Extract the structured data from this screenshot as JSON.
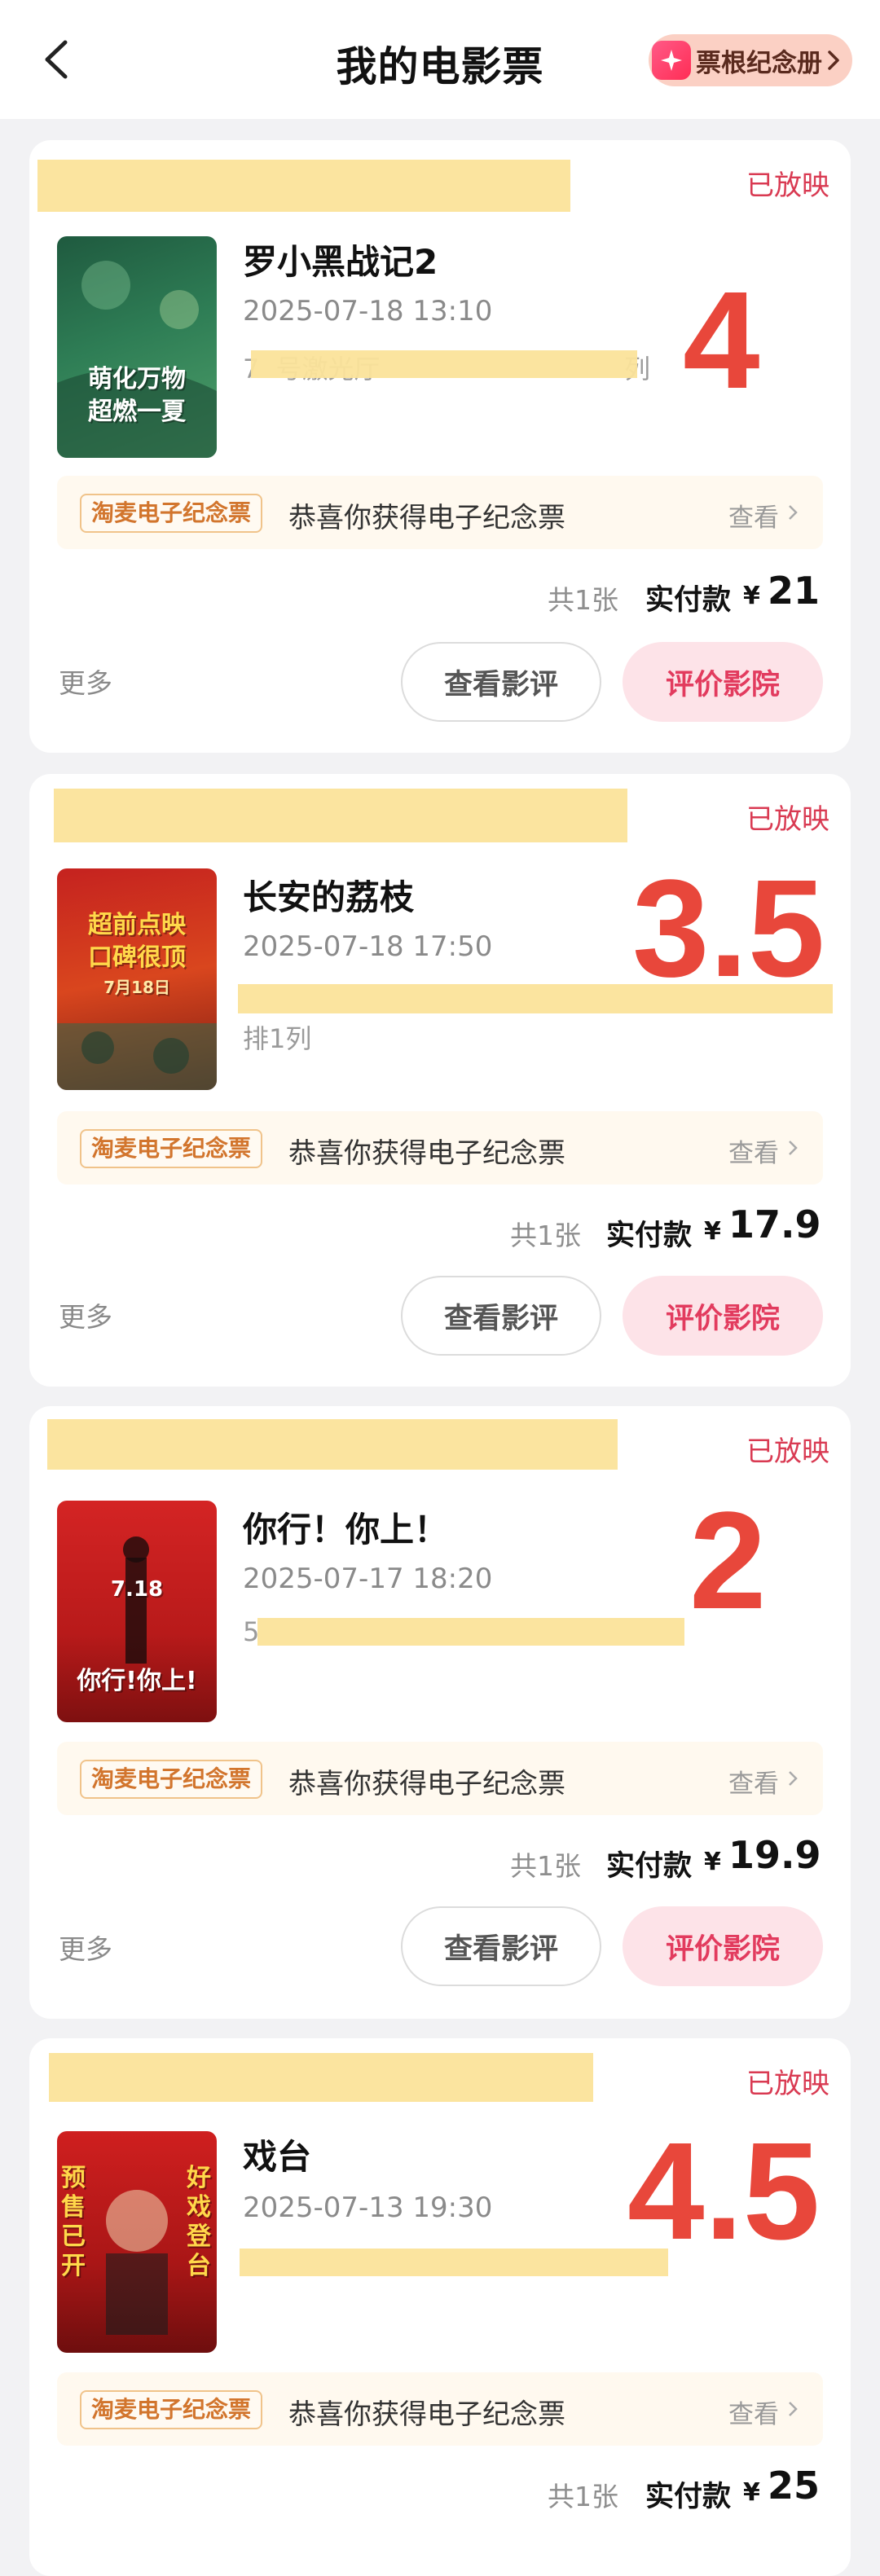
{
  "header": {
    "title": "我的电影票",
    "album_button": "票根纪念册"
  },
  "icons": {
    "back": "chevron-left-icon",
    "album": "sparkle-icon",
    "view_more": "chevron-right-icon"
  },
  "colors": {
    "accent_red": "#e8473b",
    "status_red": "#d93a52",
    "rate_button_bg": "#fde3e8",
    "highlight_yellow": "#fbe39a"
  },
  "orders": [
    {
      "status": "已放映",
      "title": "罗小黑战记2",
      "datetime": "2025-07-18 13:10",
      "seat_partial": "7",
      "seat_visible_end": "列",
      "seat_mid": "号激光厅",
      "rating": "4",
      "poster_text": [
        "萌化万物",
        "超燃一夏"
      ],
      "souvenir_badge": "淘麦电子纪念票",
      "souvenir_text": "恭喜你获得电子纪念票",
      "souvenir_view": "查看",
      "count": "共1张",
      "paid_label": "实付款",
      "currency": "¥",
      "price": "21",
      "more": "更多",
      "review_button": "查看影评",
      "rate_button": "评价影院"
    },
    {
      "status": "已放映",
      "title": "长安的荔枝",
      "datetime": "2025-07-18 17:50",
      "seat_partial": "排1列",
      "rating": "3.5",
      "poster_text": [
        "超前点映",
        "口碑很顶",
        "7月18日"
      ],
      "souvenir_badge": "淘麦电子纪念票",
      "souvenir_text": "恭喜你获得电子纪念票",
      "souvenir_view": "查看",
      "count": "共1张",
      "paid_label": "实付款",
      "currency": "¥",
      "price": "17.9",
      "more": "更多",
      "review_button": "查看影评",
      "rate_button": "评价影院"
    },
    {
      "status": "已放映",
      "title": "你行！你上！",
      "datetime": "2025-07-17 18:20",
      "seat_partial": "5",
      "rating": "2",
      "poster_text": [
        "7.18",
        "你行!你上!"
      ],
      "souvenir_badge": "淘麦电子纪念票",
      "souvenir_text": "恭喜你获得电子纪念票",
      "souvenir_view": "查看",
      "count": "共1张",
      "paid_label": "实付款",
      "currency": "¥",
      "price": "19.9",
      "more": "更多",
      "review_button": "查看影评",
      "rate_button": "评价影院"
    },
    {
      "status": "已放映",
      "title": "戏台",
      "datetime": "2025-07-13 19:30",
      "rating": "4.5",
      "poster_text": [
        "预售已开",
        "好戏登台"
      ],
      "souvenir_badge": "淘麦电子纪念票",
      "souvenir_text": "恭喜你获得电子纪念票",
      "souvenir_view": "查看",
      "count": "共1张",
      "paid_label": "实付款",
      "currency": "¥",
      "price": "25"
    }
  ]
}
